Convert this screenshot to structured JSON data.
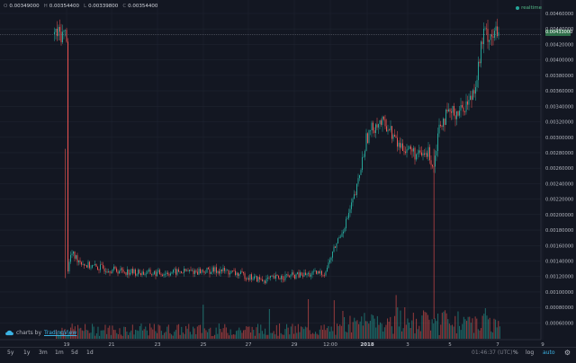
{
  "legend": {
    "open_key": "O",
    "open": "0.00349000",
    "high_key": "H",
    "high": "0.00354400",
    "low_key": "L",
    "low": "0.00339800",
    "close_key": "C",
    "close": "0.00354400"
  },
  "status": {
    "realtime": "realtime"
  },
  "last_price": "0.00433000",
  "watermark": {
    "prefix": "charts by",
    "brand": "TradingView"
  },
  "timeframes": [
    "5y",
    "1y",
    "3m",
    "1m",
    "5d",
    "1d"
  ],
  "toolbar": {
    "time": "01:46:37 (UTC)",
    "percent_label": "%",
    "log_label": "log",
    "auto_label": "auto",
    "settings_icon": "gear-icon"
  },
  "colors": {
    "up": "#26a69a",
    "down": "#ef5350",
    "background": "#131722",
    "grid": "#1f2430",
    "last_price": "#2f6f4a"
  },
  "chart_data": {
    "type": "candlestick",
    "title": "",
    "x_tick_labels": [
      "19",
      "21",
      "23",
      "25",
      "27",
      "29",
      "12:00",
      "2018",
      "3",
      "5",
      "7",
      "9"
    ],
    "y_tick_labels": [
      "0.00460000",
      "0.00440000",
      "0.00420000",
      "0.00400000",
      "0.00380000",
      "0.00360000",
      "0.00340000",
      "0.00320000",
      "0.00300000",
      "0.00280000",
      "0.00260000",
      "0.00240000",
      "0.00220000",
      "0.00200000",
      "0.00180000",
      "0.00160000",
      "0.00140000",
      "0.00120000",
      "0.00100000",
      "0.00080000",
      "0.00060000"
    ],
    "y_axis": {
      "position": "right",
      "ylim": [
        0.0006,
        0.0046
      ]
    },
    "grid": true,
    "last_value": 0.00433,
    "price_trace": [
      {
        "x": 18.6,
        "y": 0.00122
      },
      {
        "x": 18.8,
        "y": 0.0015
      },
      {
        "x": 19.0,
        "y": 0.00145
      },
      {
        "x": 19.5,
        "y": 0.00135
      },
      {
        "x": 20.0,
        "y": 0.00132
      },
      {
        "x": 21.0,
        "y": 0.00128
      },
      {
        "x": 22.0,
        "y": 0.00125
      },
      {
        "x": 23.0,
        "y": 0.00124
      },
      {
        "x": 24.0,
        "y": 0.00126
      },
      {
        "x": 25.0,
        "y": 0.00127
      },
      {
        "x": 26.0,
        "y": 0.00128
      },
      {
        "x": 27.0,
        "y": 0.00122
      },
      {
        "x": 28.0,
        "y": 0.00115
      },
      {
        "x": 29.0,
        "y": 0.0012
      },
      {
        "x": 30.0,
        "y": 0.00122
      },
      {
        "x": 31.0,
        "y": 0.00125
      },
      {
        "x": 31.5,
        "y": 0.0016
      },
      {
        "x": 32.0,
        "y": 0.0019
      },
      {
        "x": 32.5,
        "y": 0.0023
      },
      {
        "x": 33.0,
        "y": 0.003
      },
      {
        "x": 33.5,
        "y": 0.0032
      },
      {
        "x": 34.0,
        "y": 0.00315
      },
      {
        "x": 34.5,
        "y": 0.0029
      },
      {
        "x": 35.0,
        "y": 0.00285
      },
      {
        "x": 35.5,
        "y": 0.00275
      },
      {
        "x": 36.0,
        "y": 0.0028
      },
      {
        "x": 36.2,
        "y": 0.0026
      },
      {
        "x": 36.5,
        "y": 0.0032
      },
      {
        "x": 37.0,
        "y": 0.0033
      },
      {
        "x": 37.5,
        "y": 0.00335
      },
      {
        "x": 38.0,
        "y": 0.0035
      },
      {
        "x": 38.3,
        "y": 0.0038
      },
      {
        "x": 38.6,
        "y": 0.00433
      }
    ]
  }
}
